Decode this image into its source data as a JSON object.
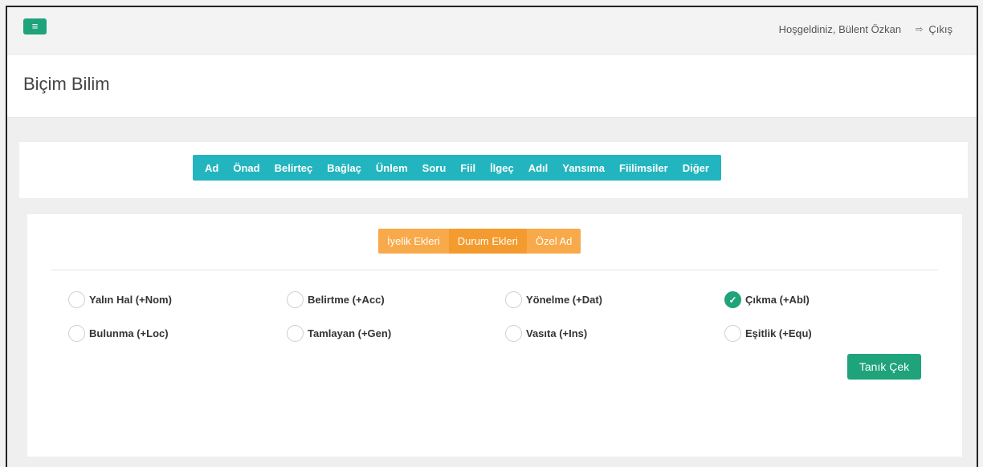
{
  "header": {
    "menu_icon": "hamburger-icon",
    "menu_glyph": "≡",
    "welcome_text": "Hoşgeldiniz, Bülent Özkan",
    "logout_icon": "logout-icon",
    "logout_glyph": "⇨",
    "logout_label": "Çıkış"
  },
  "page": {
    "title": "Biçim Bilim"
  },
  "categories": [
    "Ad",
    "Önad",
    "Belirteç",
    "Bağlaç",
    "Ünlem",
    "Soru",
    "Fiil",
    "İlgeç",
    "Adıl",
    "Yansıma",
    "Fiilimsiler",
    "Diğer"
  ],
  "subtabs": {
    "items": [
      "İyelik Ekleri",
      "Durum Ekleri",
      "Özel Ad"
    ],
    "active": "Durum Ekleri"
  },
  "options": [
    {
      "label": "Yalın Hal (+Nom)",
      "checked": false
    },
    {
      "label": "Belirtme (+Acc)",
      "checked": false
    },
    {
      "label": "Yönelme (+Dat)",
      "checked": false
    },
    {
      "label": "Çıkma (+Abl)",
      "checked": true
    },
    {
      "label": "Bulunma (+Loc)",
      "checked": false
    },
    {
      "label": "Tamlayan (+Gen)",
      "checked": false
    },
    {
      "label": "Vasıta (+Ins)",
      "checked": false
    },
    {
      "label": "Eşitlik (+Equ)",
      "checked": false
    }
  ],
  "check_glyph": "✓",
  "action": {
    "label": "Tanık Çek"
  },
  "colors": {
    "green_accent": "#1fa37a",
    "teal_nav": "#23b5bf",
    "orange_tab": "#f8a94a",
    "orange_tab_active": "#f39b2e"
  }
}
